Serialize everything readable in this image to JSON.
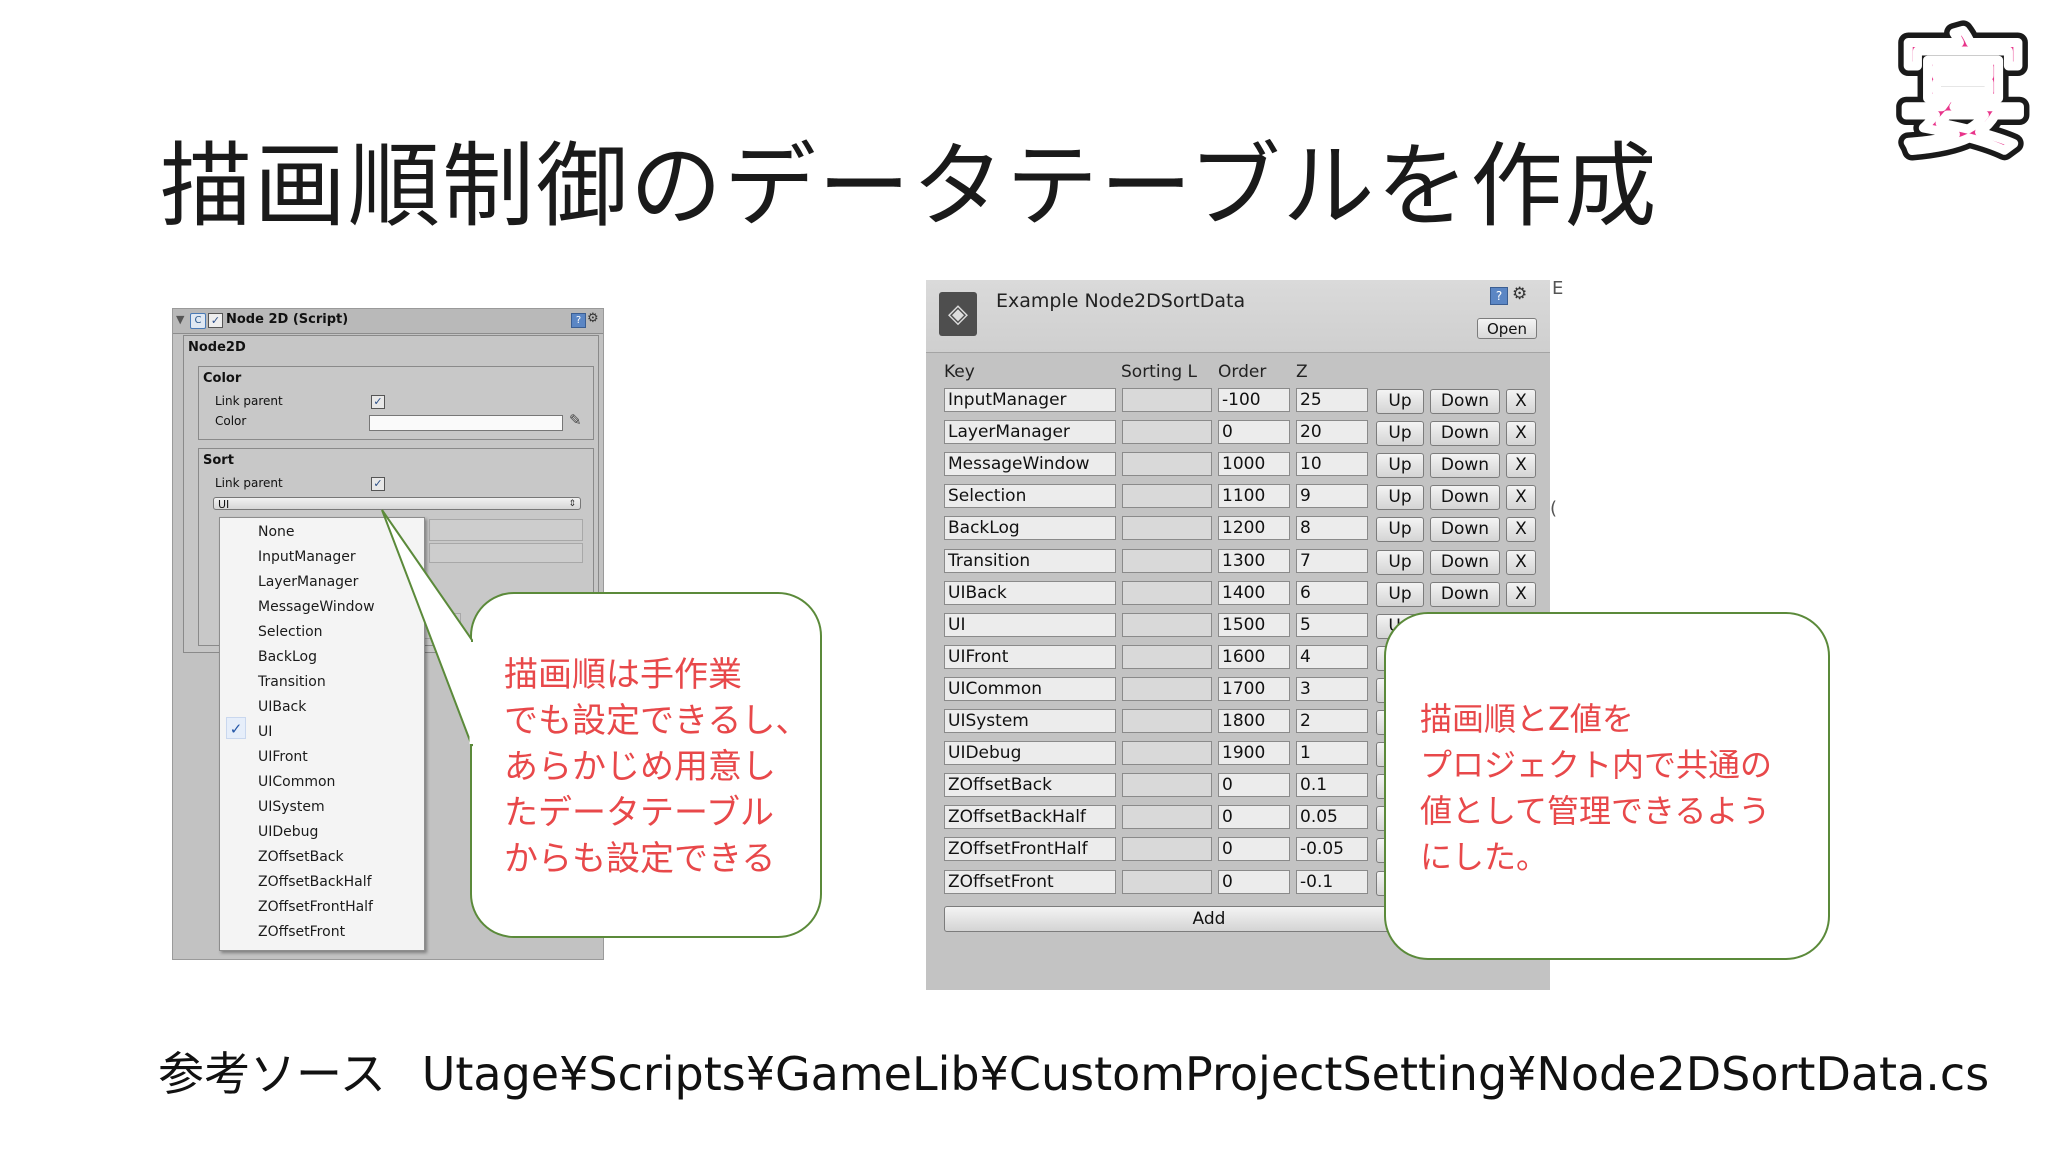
{
  "slide": {
    "title": "描画順制御のデータテーブルを作成",
    "logo_char": "宴",
    "source_label": "参考ソース",
    "source_path": "Utage¥Scripts¥GameLib¥CustomProjectSetting¥Node2DSortData.cs"
  },
  "inspector": {
    "component_title": "Node 2D (Script)",
    "section_label": "Node2D",
    "color_group": {
      "label": "Color",
      "link_parent_label": "Link parent",
      "color_label": "Color"
    },
    "sort_group": {
      "label": "Sort",
      "link_parent_label": "Link parent",
      "selected_value": "UI"
    },
    "dropdown_options": [
      "None",
      "InputManager",
      "LayerManager",
      "MessageWindow",
      "Selection",
      "BackLog",
      "Transition",
      "UIBack",
      "UI",
      "UIFront",
      "UICommon",
      "UISystem",
      "UIDebug",
      "ZOffsetBack",
      "ZOffsetBackHalf",
      "ZOffsetFrontHalf",
      "ZOffsetFront"
    ],
    "checked_option": "UI"
  },
  "sort_table": {
    "title": "Example Node2DSortData",
    "open_label": "Open",
    "columns": [
      "Key",
      "Sorting L",
      "Order",
      "Z"
    ],
    "rows": [
      {
        "key": "InputManager",
        "sorting": "",
        "order": "-100",
        "z": "25"
      },
      {
        "key": "LayerManager",
        "sorting": "",
        "order": "0",
        "z": "20"
      },
      {
        "key": "MessageWindow",
        "sorting": "",
        "order": "1000",
        "z": "10"
      },
      {
        "key": "Selection",
        "sorting": "",
        "order": "1100",
        "z": "9"
      },
      {
        "key": "BackLog",
        "sorting": "",
        "order": "1200",
        "z": "8"
      },
      {
        "key": "Transition",
        "sorting": "",
        "order": "1300",
        "z": "7"
      },
      {
        "key": "UIBack",
        "sorting": "",
        "order": "1400",
        "z": "6"
      },
      {
        "key": "UI",
        "sorting": "",
        "order": "1500",
        "z": "5"
      },
      {
        "key": "UIFront",
        "sorting": "",
        "order": "1600",
        "z": "4"
      },
      {
        "key": "UICommon",
        "sorting": "",
        "order": "1700",
        "z": "3"
      },
      {
        "key": "UISystem",
        "sorting": "",
        "order": "1800",
        "z": "2"
      },
      {
        "key": "UIDebug",
        "sorting": "",
        "order": "1900",
        "z": "1"
      },
      {
        "key": "ZOffsetBack",
        "sorting": "",
        "order": "0",
        "z": "0.1"
      },
      {
        "key": "ZOffsetBackHalf",
        "sorting": "",
        "order": "0",
        "z": "0.05"
      },
      {
        "key": "ZOffsetFrontHalf",
        "sorting": "",
        "order": "0",
        "z": "-0.05"
      },
      {
        "key": "ZOffsetFront",
        "sorting": "",
        "order": "0",
        "z": "-0.1"
      }
    ],
    "up_label": "Up",
    "down_label": "Down",
    "remove_label": "X",
    "add_label": "Add"
  },
  "callouts": {
    "left": [
      "描画順は手作業",
      "でも設定できるし、",
      "あらかじめ用意し",
      "たデータテーブル",
      "からも設定できる"
    ],
    "right": [
      "描画順とZ値を",
      "プロジェクト内で共通の",
      "値として管理できるよう",
      "にした。"
    ]
  },
  "colors": {
    "callout_text": "#e8484a",
    "callout_border": "#5b8a3a",
    "logo_fill": "#e8348a"
  }
}
